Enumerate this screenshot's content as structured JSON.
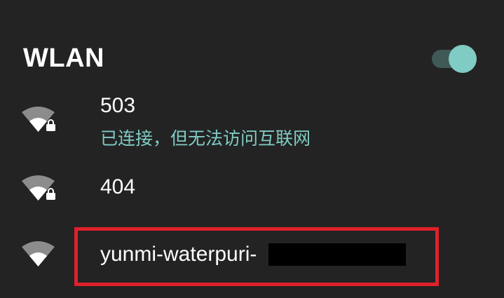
{
  "header": {
    "title": "WLAN",
    "toggle_state": "on",
    "toggle_accent": "#80cbc4"
  },
  "networks": [
    {
      "ssid": "503",
      "status": "已连接，但无法访问互联网",
      "secured": true,
      "icon": "wifi-lock-icon"
    },
    {
      "ssid": "404",
      "status": "",
      "secured": true,
      "icon": "wifi-lock-icon"
    },
    {
      "ssid": "yunmi-waterpuri-",
      "status": "",
      "secured": false,
      "redacted_suffix": true,
      "icon": "wifi-icon"
    }
  ],
  "colors": {
    "background": "#232323",
    "text": "#ffffff",
    "accent": "#80cbc4",
    "highlight": "#e0202a"
  }
}
